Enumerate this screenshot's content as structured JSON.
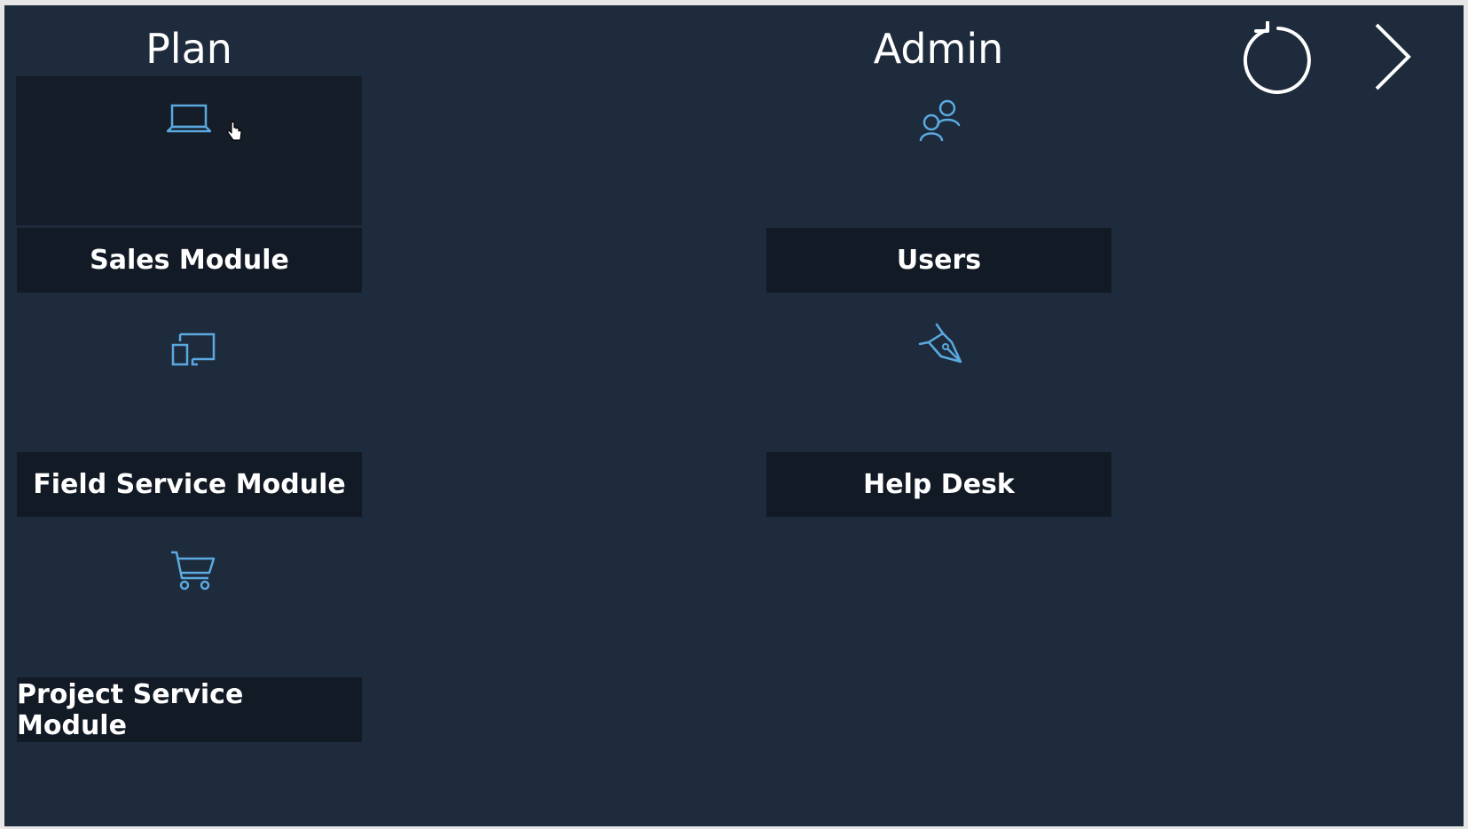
{
  "sections": {
    "plan": {
      "title": "Plan",
      "tiles": [
        {
          "label": "Sales Module",
          "icon": "laptop-icon"
        },
        {
          "label": "Field Service Module",
          "icon": "devices-icon"
        },
        {
          "label": "Project Service Module",
          "icon": "cart-icon"
        }
      ]
    },
    "admin": {
      "title": "Admin",
      "tiles": [
        {
          "label": "Users",
          "icon": "users-icon"
        },
        {
          "label": "Help Desk",
          "icon": "pen-nib-icon"
        }
      ]
    }
  },
  "toolbar": {
    "refresh_icon": "refresh-icon",
    "next_icon": "chevron-right-icon"
  },
  "colors": {
    "background": "#1e2b3c",
    "tile_label_bg": "#121a25",
    "tile_hover_bg": "#151d28",
    "icon": "#5aa9e0",
    "text": "#ffffff"
  }
}
